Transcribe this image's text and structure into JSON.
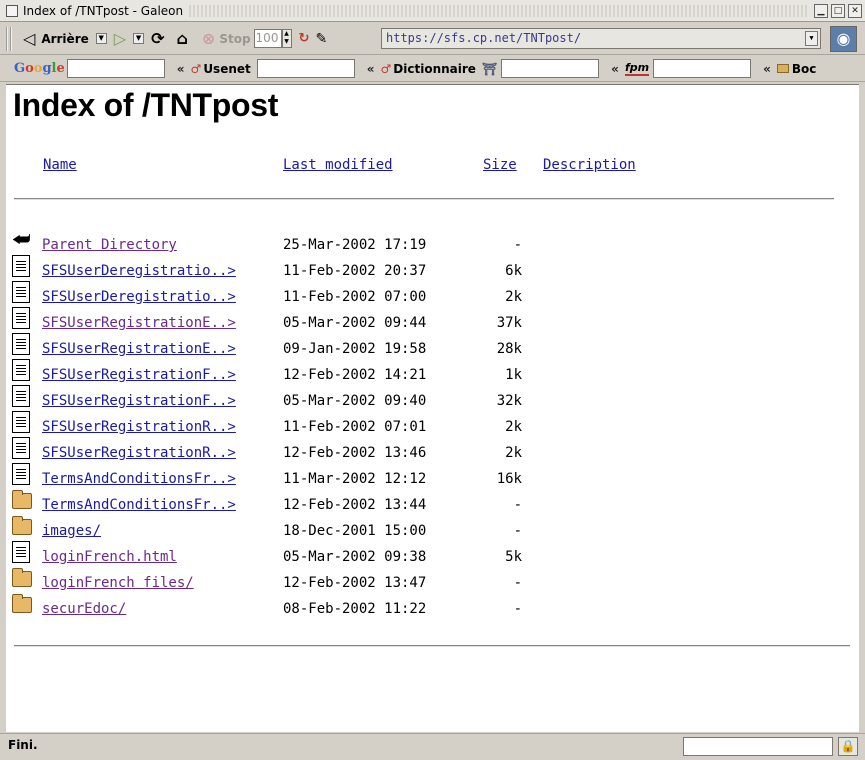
{
  "window": {
    "title": "Index of /TNTpost - Galeon"
  },
  "toolbar": {
    "back_label": "Arrière",
    "stop_label": "Stop",
    "zoom_value": "100",
    "url": "https://sfs.cp.net/TNTpost/"
  },
  "bookmarks": {
    "google": "Google",
    "usenet": "Usenet",
    "dictionnaire": "Dictionnaire",
    "fpm": "fpm",
    "boc": "Boc",
    "chevron": "«"
  },
  "page": {
    "title": "Index of /TNTpost",
    "headers": {
      "name": "Name",
      "modified": "Last modified",
      "size": "Size",
      "description": "Description"
    },
    "rows": [
      {
        "icon": "back",
        "name": "Parent Directory",
        "date": "25-Mar-2002 17:19",
        "size": "-",
        "visited": true
      },
      {
        "icon": "file",
        "name": "SFSUserDeregistratio..>",
        "date": "11-Feb-2002 20:37",
        "size": "6k",
        "visited": false
      },
      {
        "icon": "file",
        "name": "SFSUserDeregistratio..>",
        "date": "11-Feb-2002 07:00",
        "size": "2k",
        "visited": false
      },
      {
        "icon": "file",
        "name": "SFSUserRegistrationE..>",
        "date": "05-Mar-2002 09:44",
        "size": "37k",
        "visited": true
      },
      {
        "icon": "file",
        "name": "SFSUserRegistrationE..>",
        "date": "09-Jan-2002 19:58",
        "size": "28k",
        "visited": false
      },
      {
        "icon": "file",
        "name": "SFSUserRegistrationF..>",
        "date": "12-Feb-2002 14:21",
        "size": "1k",
        "visited": false
      },
      {
        "icon": "file",
        "name": "SFSUserRegistrationF..>",
        "date": "05-Mar-2002 09:40",
        "size": "32k",
        "visited": false
      },
      {
        "icon": "file",
        "name": "SFSUserRegistrationR..>",
        "date": "11-Feb-2002 07:01",
        "size": "2k",
        "visited": false
      },
      {
        "icon": "file",
        "name": "SFSUserRegistrationR..>",
        "date": "12-Feb-2002 13:46",
        "size": "2k",
        "visited": false
      },
      {
        "icon": "file",
        "name": "TermsAndConditionsFr..>",
        "date": "11-Mar-2002 12:12",
        "size": "16k",
        "visited": false
      },
      {
        "icon": "folder",
        "name": "TermsAndConditionsFr..>",
        "date": "12-Feb-2002 13:44",
        "size": "-",
        "visited": false
      },
      {
        "icon": "folder",
        "name": "images/",
        "date": "18-Dec-2001 15:00",
        "size": "-",
        "visited": false
      },
      {
        "icon": "file",
        "name": "loginFrench.html",
        "date": "05-Mar-2002 09:38",
        "size": "5k",
        "visited": true
      },
      {
        "icon": "folder",
        "name": "loginFrench files/",
        "date": "12-Feb-2002 13:47",
        "size": "-",
        "visited": true
      },
      {
        "icon": "folder",
        "name": "securEdoc/",
        "date": "08-Feb-2002 11:22",
        "size": "-",
        "visited": true
      }
    ]
  },
  "status": {
    "text": "Fini."
  }
}
